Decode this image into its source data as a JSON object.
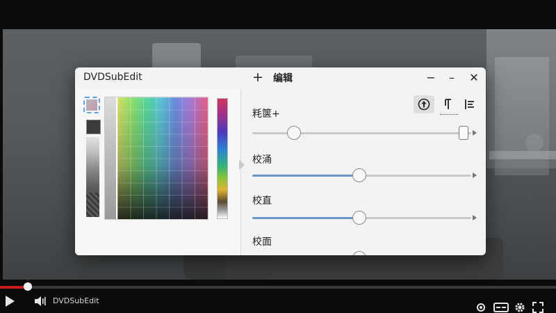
{
  "player": {
    "title": "DVDSubEdit",
    "progress": 0.05,
    "icons": [
      "play-icon",
      "volume-icon",
      "location-icon",
      "subtitles-icon",
      "gear-icon",
      "fullscreen-icon"
    ]
  },
  "dialog": {
    "title": "DVDSubEdit",
    "menu_plus": "+",
    "menu_edit": "编辑",
    "controls": {
      "minimize": "−",
      "minimize_alt": "–",
      "close": "✕"
    },
    "toggles": {
      "active_index": 0,
      "icons": [
        "up-arrow-circle-icon",
        "text-direction-icon",
        "align-left-icon"
      ]
    },
    "sliders": [
      {
        "label": "粍箧+",
        "value": 0.19
      },
      {
        "label": "校涌",
        "value": 0.49
      },
      {
        "label": "校直",
        "value": 0.49
      },
      {
        "label": "校面",
        "value": 0.49
      }
    ]
  },
  "colors": {
    "accent": "#6a95c8",
    "progress_red": "#c81e1e",
    "dialog_bg": "#f3f3f3"
  }
}
